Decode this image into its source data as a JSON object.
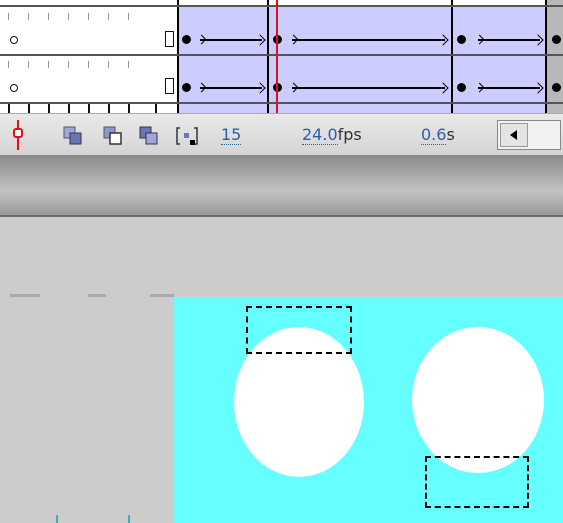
{
  "timeline": {
    "layers": [
      {
        "row": 1,
        "keyframes": [
          "hollow",
          "blank-end",
          "tween",
          "tween",
          "tween"
        ]
      },
      {
        "row": 2,
        "keyframes": [
          "hollow",
          "blank-end",
          "tween",
          "tween",
          "tween"
        ]
      }
    ],
    "tween_color": "#ccccff",
    "playhead_color": "#e0101a"
  },
  "status_bar": {
    "current_frame": "15",
    "frame_rate": "24.0",
    "frame_rate_unit": "fps",
    "elapsed_time": "0.6",
    "elapsed_time_unit": "s",
    "icons": [
      "playhead-marker-icon",
      "onion-skin-icon",
      "onion-skin-outlines-icon",
      "edit-multiple-frames-icon",
      "modify-onion-markers-icon"
    ]
  },
  "stage": {
    "background_color": "#66ffff",
    "shapes": [
      "circle-left",
      "circle-right"
    ],
    "selections": [
      "selection-box-top",
      "selection-box-bottom"
    ]
  }
}
